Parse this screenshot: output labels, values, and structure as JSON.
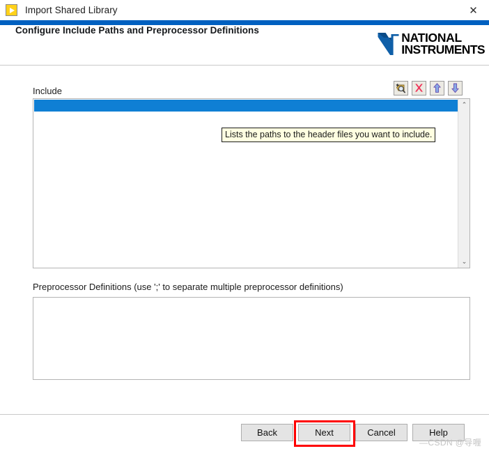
{
  "window": {
    "title": "Import Shared Library",
    "icon": "labview-run-icon",
    "close_label": "✕"
  },
  "header": {
    "title": "Configure Include Paths and Preprocessor Definitions",
    "logo": {
      "line1": "NATIONAL",
      "line2": "INSTRUMENTS",
      "trademark": "™",
      "mark_color": "#0f5fa8",
      "text_color": "#000000"
    }
  },
  "theme": {
    "accent_band": "#0060c0",
    "selection_blue": "#0f7fd4",
    "highlight_red": "#fe0000",
    "tooltip_bg": "#ffffe1",
    "button_face": "#e4e4e4"
  },
  "include_section": {
    "label": "Include",
    "selected_row_value": "",
    "rows": [],
    "toolbar": [
      {
        "name": "browse-paths-button",
        "icon": "magnifier-sparkle-icon",
        "title": "Browse"
      },
      {
        "name": "delete-path-button",
        "icon": "red-x-icon",
        "title": "Delete"
      },
      {
        "name": "move-up-button",
        "icon": "arrow-up-icon",
        "title": "Move Up"
      },
      {
        "name": "move-down-button",
        "icon": "arrow-down-icon",
        "title": "Move Down"
      }
    ],
    "scrollbar": {
      "up_glyph": "⌃",
      "down_glyph": "⌄"
    }
  },
  "tooltip": {
    "text": "Lists the paths to the header files you want to include."
  },
  "preprocessor_section": {
    "label": "Preprocessor Definitions (use ';' to separate multiple preprocessor definitions)",
    "value": "",
    "placeholder": ""
  },
  "footer": {
    "buttons": [
      {
        "name": "back-button",
        "label": "Back",
        "highlighted": false
      },
      {
        "name": "next-button",
        "label": "Next",
        "highlighted": true
      },
      {
        "name": "cancel-button",
        "label": "Cancel",
        "highlighted": false
      },
      {
        "name": "help-button",
        "label": "Help",
        "highlighted": false
      }
    ]
  },
  "watermark": {
    "text": "—CSDN @导喱"
  }
}
